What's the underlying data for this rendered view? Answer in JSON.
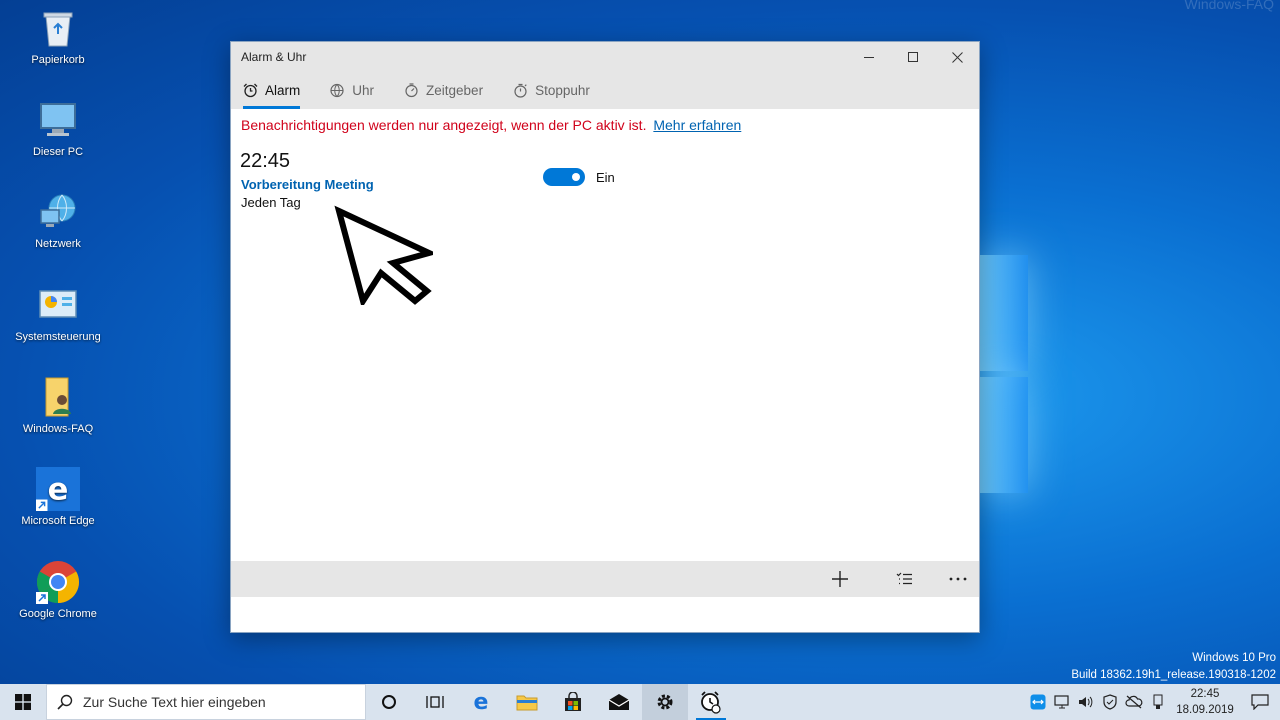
{
  "desktop": {
    "watermark": "Windows-FAQ",
    "icons": [
      {
        "label": "Papierkorb",
        "icon": "recycle-bin-icon"
      },
      {
        "label": "Dieser PC",
        "icon": "computer-icon"
      },
      {
        "label": "Netzwerk",
        "icon": "network-icon"
      },
      {
        "label": "Systemsteuerung",
        "icon": "control-panel-icon"
      },
      {
        "label": "Windows-FAQ",
        "icon": "folder-user-icon"
      },
      {
        "label": "Microsoft Edge",
        "icon": "edge-icon"
      },
      {
        "label": "Google Chrome",
        "icon": "chrome-icon"
      }
    ],
    "build_line1": "Windows 10 Pro",
    "build_line2": "Build 18362.19h1_release.190318-1202"
  },
  "window": {
    "title": "Alarm & Uhr",
    "tabs": [
      {
        "label": "Alarm",
        "icon": "alarm-clock-icon",
        "active": true
      },
      {
        "label": "Uhr",
        "icon": "globe-clock-icon",
        "active": false
      },
      {
        "label": "Zeitgeber",
        "icon": "timer-icon",
        "active": false
      },
      {
        "label": "Stoppuhr",
        "icon": "stopwatch-icon",
        "active": false
      }
    ],
    "notice": "Benachrichtigungen werden nur angezeigt, wenn der PC aktiv ist.",
    "notice_link": "Mehr erfahren",
    "alarm": {
      "time": "22:45",
      "name": "Vorbereitung Meeting",
      "repeat": "Jeden Tag",
      "toggle_on": true,
      "toggle_label": "Ein"
    }
  },
  "taskbar": {
    "search_placeholder": "Zur Suche Text hier eingeben",
    "time": "22:45",
    "date": "18.09.2019"
  },
  "colors": {
    "accent": "#0078d7",
    "notice_red": "#d0021b",
    "link_blue": "#0063b1"
  }
}
